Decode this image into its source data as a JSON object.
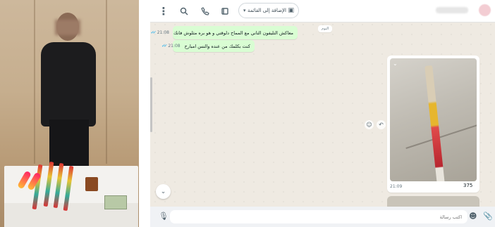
{
  "header": {
    "add_to_list_label": "الإضافة إلى القائمة",
    "icons": [
      "menu-icon",
      "search-icon",
      "call-icon",
      "video-icon",
      "list-icon"
    ]
  },
  "chat": {
    "date_chip": "اليوم",
    "messages": [
      {
        "text": "معاكش التليفون التاني مع المماح دلوقتي و هو بره مثلوش فانك",
        "time": "21:08"
      },
      {
        "text": "كنت بكلمك من عنده والنس امبارح",
        "time": "21:08"
      }
    ],
    "media": {
      "count": "375",
      "time": "21:09"
    }
  },
  "composer": {
    "placeholder": "اكتب رسالة"
  },
  "colors": {
    "outgoing_bubble": "#d9fdd3",
    "background": "#efeae2",
    "read_ticks": "#53bdeb"
  }
}
